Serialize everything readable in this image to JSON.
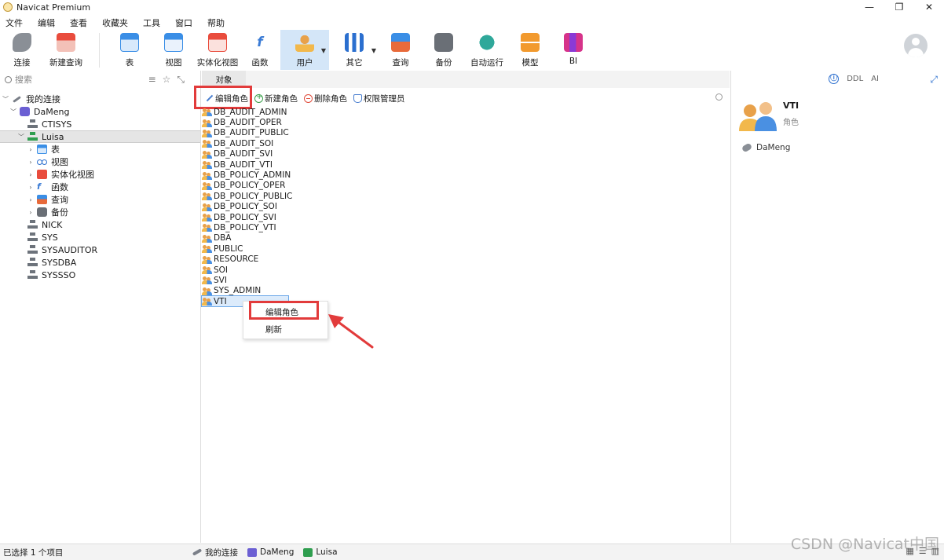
{
  "window": {
    "title": "Navicat Premium",
    "controls": [
      "—",
      "❐",
      "✕"
    ]
  },
  "menu": [
    "文件",
    "编辑",
    "查看",
    "收藏夹",
    "工具",
    "窗口",
    "帮助"
  ],
  "toolbar": {
    "connect": "连接",
    "new_query": "新建查询",
    "table": "表",
    "view": "视图",
    "mview": "实体化视图",
    "function": "函数",
    "user": "用户",
    "other": "其它",
    "query": "查询",
    "backup": "备份",
    "automation": "自动运行",
    "model": "模型",
    "bi": "BI"
  },
  "sidebar": {
    "search_placeholder": "搜索",
    "root": "我的连接",
    "connection": "DaMeng",
    "schemas_top": [
      "CTISYS"
    ],
    "selected_schema": "Luisa",
    "children": [
      "表",
      "视图",
      "实体化视图",
      "函数",
      "查询",
      "备份"
    ],
    "schemas_bottom": [
      "NICK",
      "SYS",
      "SYSAUDITOR",
      "SYSDBA",
      "SYSSSO"
    ]
  },
  "center": {
    "tab": "对象",
    "actions": {
      "edit": "编辑角色",
      "new": "新建角色",
      "delete": "删除角色",
      "admin": "权限管理员"
    },
    "roles": [
      "DB_AUDIT_ADMIN",
      "DB_AUDIT_OPER",
      "DB_AUDIT_PUBLIC",
      "DB_AUDIT_SOI",
      "DB_AUDIT_SVI",
      "DB_AUDIT_VTI",
      "DB_POLICY_ADMIN",
      "DB_POLICY_OPER",
      "DB_POLICY_PUBLIC",
      "DB_POLICY_SOI",
      "DB_POLICY_SVI",
      "DB_POLICY_VTI",
      "DBA",
      "PUBLIC",
      "RESOURCE",
      "SOI",
      "SVI",
      "SYS_ADMIN",
      "VTI"
    ],
    "context_menu": {
      "edit": "编辑角色",
      "refresh": "刷新"
    }
  },
  "details": {
    "name": "VTI",
    "type": "角色",
    "connection": "DaMeng",
    "tools": [
      "ⓘ",
      "DDL",
      "AI"
    ]
  },
  "status": {
    "selection": "已选择 1 个项目",
    "crumbs": [
      "我的连接",
      "DaMeng",
      "Luisa"
    ],
    "watermark": "CSDN @Navicat中国"
  },
  "colors": {
    "highlight": "#e23b3b",
    "selection": "#dcebfb",
    "accent": "#2b6fcf"
  }
}
